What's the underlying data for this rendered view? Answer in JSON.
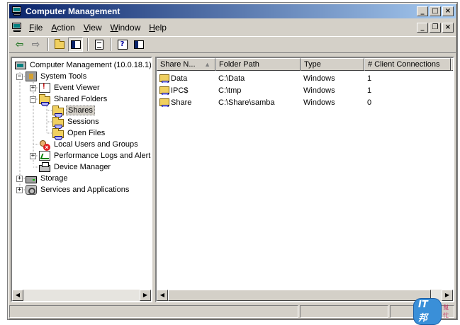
{
  "window": {
    "title": "Computer Management"
  },
  "menu": {
    "items": [
      {
        "label": "File",
        "key": "F",
        "rest": "ile"
      },
      {
        "label": "Action",
        "key": "A",
        "rest": "ction"
      },
      {
        "label": "View",
        "key": "V",
        "rest": "iew"
      },
      {
        "label": "Window",
        "key": "W",
        "rest": "indow"
      },
      {
        "label": "Help",
        "key": "H",
        "rest": "elp"
      }
    ]
  },
  "toolbar": {
    "buttons": [
      "back-arrow-icon",
      "forward-arrow-icon",
      "up-one-level-icon",
      "show-hide-tree-icon",
      "export-list-icon",
      "help-icon",
      "show-hide-action-pane-icon"
    ]
  },
  "tree": {
    "root": "Computer Management (10.0.18.1)",
    "nodes": {
      "system_tools": "System Tools",
      "event_viewer": "Event Viewer",
      "shared_folders": "Shared Folders",
      "shares": "Shares",
      "sessions": "Sessions",
      "open_files": "Open Files",
      "local_users": "Local Users and Groups",
      "perf_logs": "Performance Logs and Alerts",
      "device_manager": "Device Manager",
      "storage": "Storage",
      "services": "Services and Applications"
    },
    "selected": "Shares"
  },
  "list": {
    "columns": [
      "Share N...",
      "Folder Path",
      "Type",
      "# Client Connections"
    ],
    "sorted_column": "Share N...",
    "rows": [
      {
        "name": "Data",
        "path": "C:\\Data",
        "type": "Windows",
        "connections": "1"
      },
      {
        "name": "IPC$",
        "path": "C:\\tmp",
        "type": "Windows",
        "connections": "1"
      },
      {
        "name": "Share",
        "path": "C:\\Share\\samba",
        "type": "Windows",
        "connections": "0"
      }
    ]
  },
  "colors": {
    "title_bar_start": "#0a246a",
    "title_bar_end": "#a6caf0",
    "chrome": "#d4d0c8"
  }
}
